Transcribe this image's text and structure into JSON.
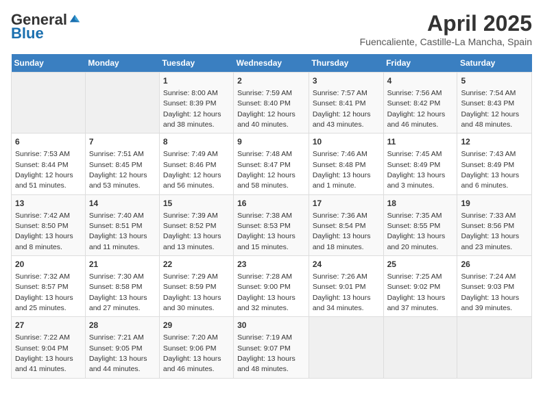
{
  "header": {
    "logo_general": "General",
    "logo_blue": "Blue",
    "month": "April 2025",
    "location": "Fuencaliente, Castille-La Mancha, Spain"
  },
  "weekdays": [
    "Sunday",
    "Monday",
    "Tuesday",
    "Wednesday",
    "Thursday",
    "Friday",
    "Saturday"
  ],
  "weeks": [
    [
      {
        "day": "",
        "info": ""
      },
      {
        "day": "",
        "info": ""
      },
      {
        "day": "1",
        "info": "Sunrise: 8:00 AM\nSunset: 8:39 PM\nDaylight: 12 hours and 38 minutes."
      },
      {
        "day": "2",
        "info": "Sunrise: 7:59 AM\nSunset: 8:40 PM\nDaylight: 12 hours and 40 minutes."
      },
      {
        "day": "3",
        "info": "Sunrise: 7:57 AM\nSunset: 8:41 PM\nDaylight: 12 hours and 43 minutes."
      },
      {
        "day": "4",
        "info": "Sunrise: 7:56 AM\nSunset: 8:42 PM\nDaylight: 12 hours and 46 minutes."
      },
      {
        "day": "5",
        "info": "Sunrise: 7:54 AM\nSunset: 8:43 PM\nDaylight: 12 hours and 48 minutes."
      }
    ],
    [
      {
        "day": "6",
        "info": "Sunrise: 7:53 AM\nSunset: 8:44 PM\nDaylight: 12 hours and 51 minutes."
      },
      {
        "day": "7",
        "info": "Sunrise: 7:51 AM\nSunset: 8:45 PM\nDaylight: 12 hours and 53 minutes."
      },
      {
        "day": "8",
        "info": "Sunrise: 7:49 AM\nSunset: 8:46 PM\nDaylight: 12 hours and 56 minutes."
      },
      {
        "day": "9",
        "info": "Sunrise: 7:48 AM\nSunset: 8:47 PM\nDaylight: 12 hours and 58 minutes."
      },
      {
        "day": "10",
        "info": "Sunrise: 7:46 AM\nSunset: 8:48 PM\nDaylight: 13 hours and 1 minute."
      },
      {
        "day": "11",
        "info": "Sunrise: 7:45 AM\nSunset: 8:49 PM\nDaylight: 13 hours and 3 minutes."
      },
      {
        "day": "12",
        "info": "Sunrise: 7:43 AM\nSunset: 8:49 PM\nDaylight: 13 hours and 6 minutes."
      }
    ],
    [
      {
        "day": "13",
        "info": "Sunrise: 7:42 AM\nSunset: 8:50 PM\nDaylight: 13 hours and 8 minutes."
      },
      {
        "day": "14",
        "info": "Sunrise: 7:40 AM\nSunset: 8:51 PM\nDaylight: 13 hours and 11 minutes."
      },
      {
        "day": "15",
        "info": "Sunrise: 7:39 AM\nSunset: 8:52 PM\nDaylight: 13 hours and 13 minutes."
      },
      {
        "day": "16",
        "info": "Sunrise: 7:38 AM\nSunset: 8:53 PM\nDaylight: 13 hours and 15 minutes."
      },
      {
        "day": "17",
        "info": "Sunrise: 7:36 AM\nSunset: 8:54 PM\nDaylight: 13 hours and 18 minutes."
      },
      {
        "day": "18",
        "info": "Sunrise: 7:35 AM\nSunset: 8:55 PM\nDaylight: 13 hours and 20 minutes."
      },
      {
        "day": "19",
        "info": "Sunrise: 7:33 AM\nSunset: 8:56 PM\nDaylight: 13 hours and 23 minutes."
      }
    ],
    [
      {
        "day": "20",
        "info": "Sunrise: 7:32 AM\nSunset: 8:57 PM\nDaylight: 13 hours and 25 minutes."
      },
      {
        "day": "21",
        "info": "Sunrise: 7:30 AM\nSunset: 8:58 PM\nDaylight: 13 hours and 27 minutes."
      },
      {
        "day": "22",
        "info": "Sunrise: 7:29 AM\nSunset: 8:59 PM\nDaylight: 13 hours and 30 minutes."
      },
      {
        "day": "23",
        "info": "Sunrise: 7:28 AM\nSunset: 9:00 PM\nDaylight: 13 hours and 32 minutes."
      },
      {
        "day": "24",
        "info": "Sunrise: 7:26 AM\nSunset: 9:01 PM\nDaylight: 13 hours and 34 minutes."
      },
      {
        "day": "25",
        "info": "Sunrise: 7:25 AM\nSunset: 9:02 PM\nDaylight: 13 hours and 37 minutes."
      },
      {
        "day": "26",
        "info": "Sunrise: 7:24 AM\nSunset: 9:03 PM\nDaylight: 13 hours and 39 minutes."
      }
    ],
    [
      {
        "day": "27",
        "info": "Sunrise: 7:22 AM\nSunset: 9:04 PM\nDaylight: 13 hours and 41 minutes."
      },
      {
        "day": "28",
        "info": "Sunrise: 7:21 AM\nSunset: 9:05 PM\nDaylight: 13 hours and 44 minutes."
      },
      {
        "day": "29",
        "info": "Sunrise: 7:20 AM\nSunset: 9:06 PM\nDaylight: 13 hours and 46 minutes."
      },
      {
        "day": "30",
        "info": "Sunrise: 7:19 AM\nSunset: 9:07 PM\nDaylight: 13 hours and 48 minutes."
      },
      {
        "day": "",
        "info": ""
      },
      {
        "day": "",
        "info": ""
      },
      {
        "day": "",
        "info": ""
      }
    ]
  ]
}
